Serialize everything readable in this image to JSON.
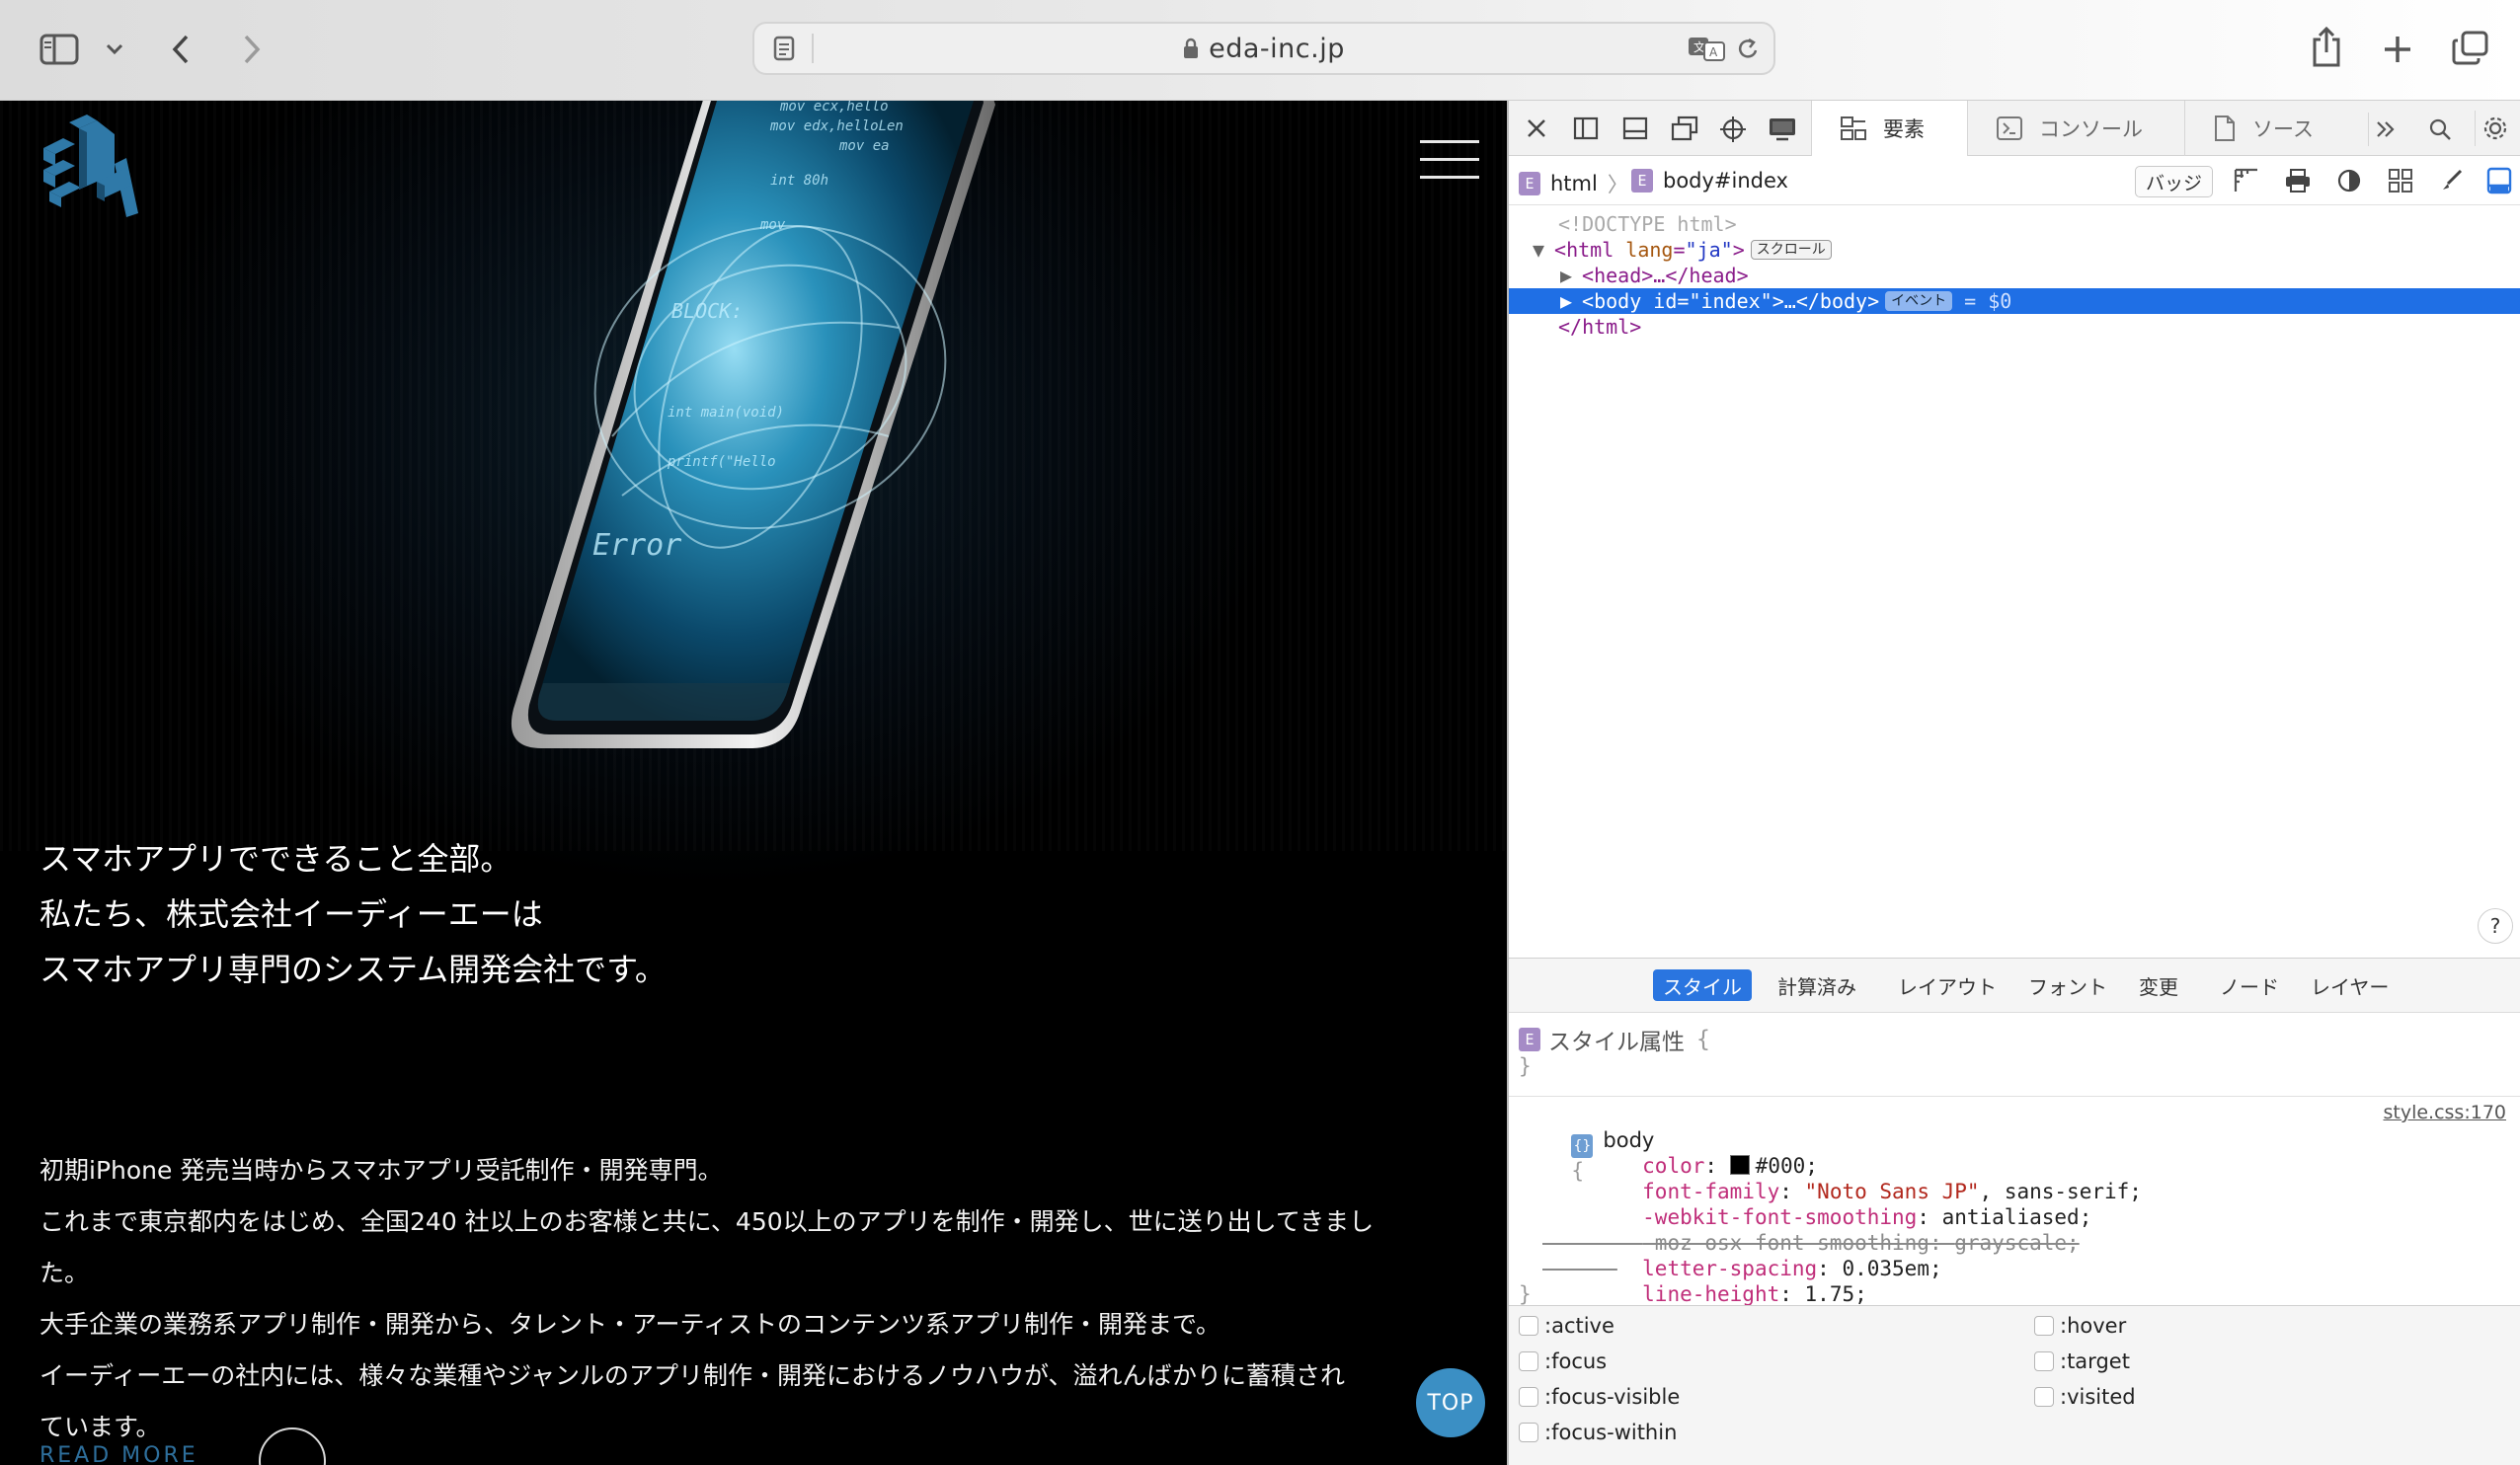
{
  "browser": {
    "url": "eda-inc.jp"
  },
  "site": {
    "headline": [
      "スマホアプリでできること全部。",
      "私たち、株式会社イーディーエーは",
      "スマホアプリ専門のシステム開発会社です。"
    ],
    "paragraph": [
      "初期iPhone 発売当時からスマホアプリ受託制作・開発専門。",
      "これまで東京都内をはじめ、全国240 社以上のお客様と共に、450以上のアプリを制作・開発し、世に送り出してきまし",
      "た。",
      "大手企業の業務系アプリ制作・開発から、タレント・アーティストのコンテンツ系アプリ制作・開発まで。",
      "イーディーエーの社内には、様々な業種やジャンルのアプリ制作・開発におけるノウハウが、溢れんばかりに蓄積され",
      "ています。"
    ],
    "top_button": "TOP",
    "read_more": "READ MORE",
    "phone_screen_text": [
      "mov ecx,hello",
      "mov edx,helloLen",
      "mov ea",
      "int 80h",
      "mov",
      "BLOCK:",
      "printf(\"Hello",
      "int main(void)",
      "Error"
    ]
  },
  "devtools": {
    "tabs": [
      {
        "label": "要素",
        "active": true
      },
      {
        "label": "コンソール",
        "active": false
      },
      {
        "label": "ソース",
        "active": false
      }
    ],
    "breadcrumb": [
      "html",
      "body#index"
    ],
    "badge_button": "バッジ",
    "dom": {
      "doctype": "<!DOCTYPE html>",
      "html_open_tag": "<html",
      "html_attr_name": " lang",
      "html_attr_eq": "=",
      "html_attr_value": "\"ja\"",
      "html_open_close": ">",
      "scroll_pill": "スクロール",
      "head": "<head>…</head>",
      "body_open": "<body",
      "body_attr_name": " id",
      "body_attr_eq": "=",
      "body_attr_value": "\"index\"",
      "body_rest": ">…</body>",
      "event_pill": "イベント",
      "body_ref": " = $0",
      "html_close": "</html>"
    },
    "help": "?",
    "sub_tabs": [
      {
        "label": "スタイル",
        "active": true
      },
      {
        "label": "計算済み",
        "active": false
      },
      {
        "label": "レイアウト",
        "active": false
      },
      {
        "label": "フォント",
        "active": false
      },
      {
        "label": "変更",
        "active": false
      },
      {
        "label": "ノード",
        "active": false
      },
      {
        "label": "レイヤー",
        "active": false
      }
    ],
    "styles": {
      "style_attr_label": "スタイル属性",
      "open_brace": "{",
      "close_brace": "}",
      "rule_selector": "body",
      "rule_source": "style.css:170",
      "decls": [
        {
          "prop": "color",
          "value": "#000",
          "swatch": "#000000",
          "struck": false
        },
        {
          "prop": "font-family",
          "value_str": "\"Noto Sans JP\"",
          "value": ", sans-serif",
          "struck": false
        },
        {
          "prop": "-webkit-font-smoothing",
          "value": "antialiased",
          "struck": false
        },
        {
          "prop": "-moz-osx-font-smoothing",
          "value": "grayscale",
          "struck": true
        },
        {
          "prop": "letter-spacing",
          "value": "0.035em",
          "struck": false
        },
        {
          "prop": "line-height",
          "value": "1.75",
          "struck": false
        }
      ]
    },
    "pseudo_classes_left": [
      ":active",
      ":focus",
      ":focus-visible",
      ":focus-within"
    ],
    "pseudo_classes_right": [
      ":hover",
      ":target",
      ":visited"
    ]
  },
  "colors": {
    "accent_blue": "#1f6fe5",
    "top_button": "#3b8fc4",
    "site_background": "#000000"
  }
}
